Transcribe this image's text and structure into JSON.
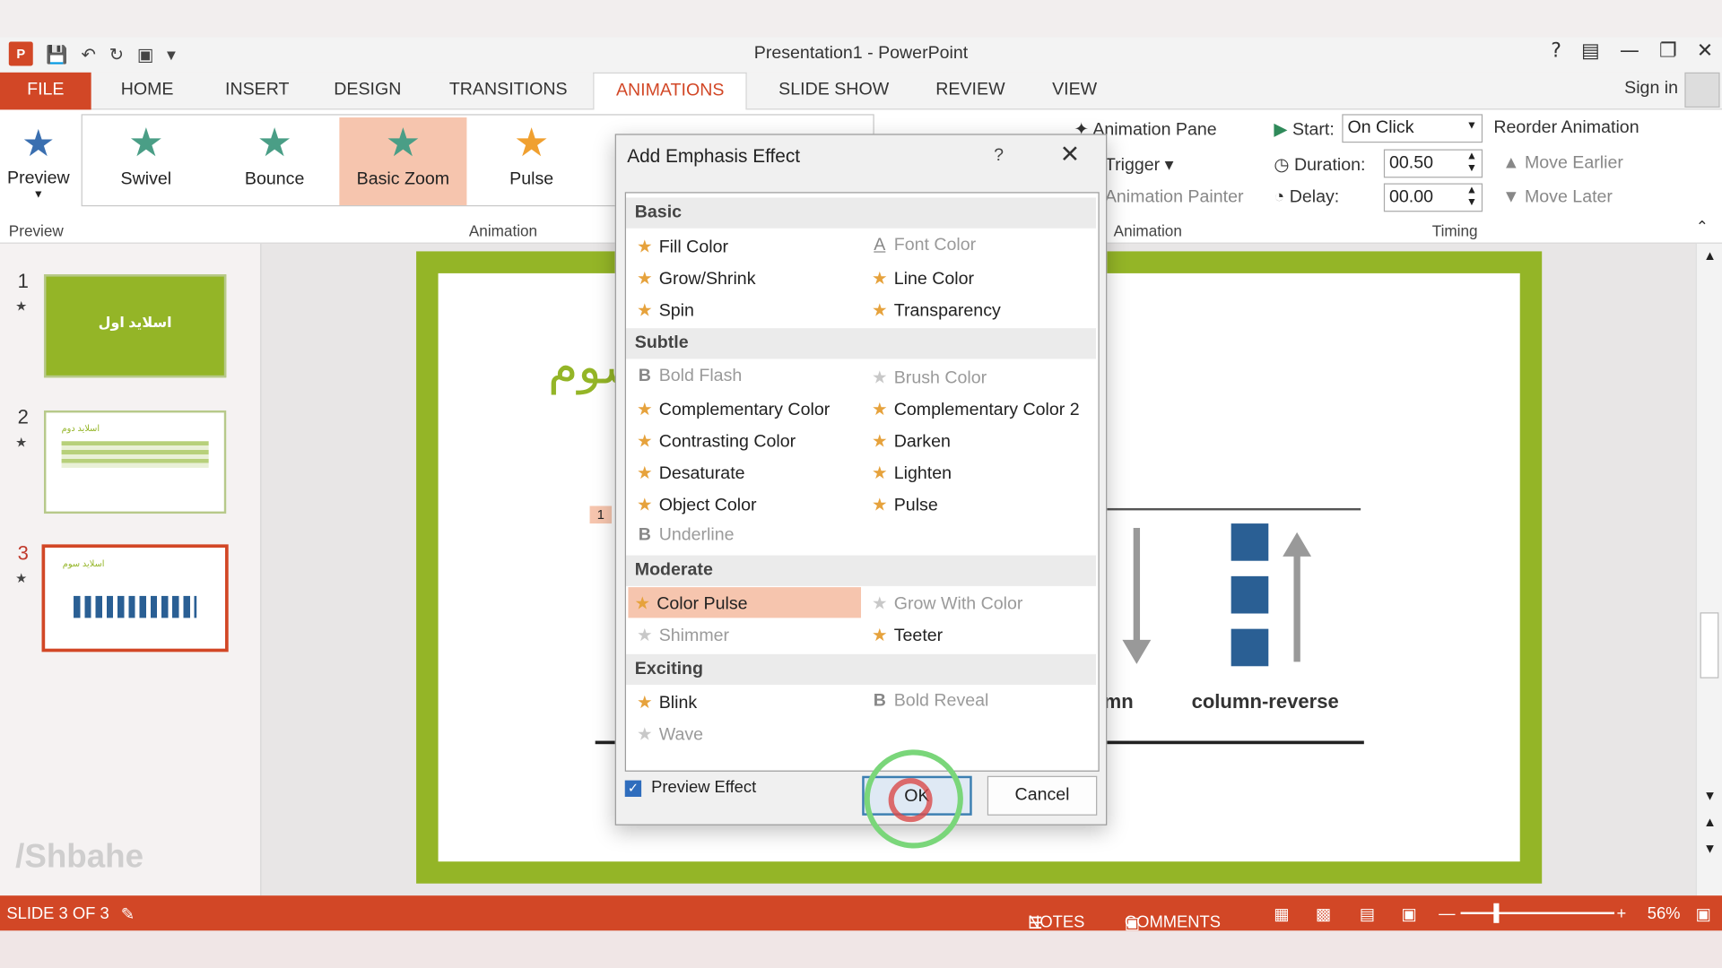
{
  "window": {
    "title": "Presentation1 - PowerPoint",
    "help": "?"
  },
  "tabs": [
    "FILE",
    "HOME",
    "INSERT",
    "DESIGN",
    "TRANSITIONS",
    "ANIMATIONS",
    "SLIDE SHOW",
    "REVIEW",
    "VIEW"
  ],
  "sign_in": "Sign in",
  "ribbon": {
    "preview_label": "Preview",
    "preview_group": "Preview",
    "animation_group": "Animation",
    "advanced_group": "Animation",
    "timing_group": "Timing",
    "gallery": [
      {
        "label": "Swivel",
        "icon": "swivel-star-icon"
      },
      {
        "label": "Bounce",
        "icon": "bounce-star-icon"
      },
      {
        "label": "Basic Zoom",
        "icon": "zoom-star-icon"
      },
      {
        "label": "Pulse",
        "icon": "pulse-star-icon"
      }
    ],
    "animation_pane": "Animation Pane",
    "trigger": "Trigger",
    "animation_painter": "Animation Painter",
    "start_label": "Start:",
    "start_value": "On Click",
    "duration_label": "Duration:",
    "duration_value": "00.50",
    "delay_label": "Delay:",
    "delay_value": "00.00",
    "reorder": "Reorder Animation",
    "move_earlier": "Move Earlier",
    "move_later": "Move Later"
  },
  "slides": [
    {
      "num": "1",
      "title": "اسلاید اول"
    },
    {
      "num": "2",
      "title": "اسلاید دوم"
    },
    {
      "num": "3",
      "title": "اسلاید سوم"
    }
  ],
  "slide": {
    "heading": "سوم",
    "seq_badge": "1",
    "label_column": "mn",
    "label_column_reverse": "column-reverse"
  },
  "dialog": {
    "title": "Add Emphasis Effect",
    "help": "?",
    "categories": {
      "basic": "Basic",
      "subtle": "Subtle",
      "moderate": "Moderate",
      "exciting": "Exciting"
    },
    "effects": {
      "fill_color": "Fill Color",
      "font_color": "Font Color",
      "grow_shrink": "Grow/Shrink",
      "line_color": "Line Color",
      "spin": "Spin",
      "transparency": "Transparency",
      "bold_flash": "Bold Flash",
      "brush_color": "Brush Color",
      "complementary_color": "Complementary Color",
      "complementary_color_2": "Complementary Color 2",
      "contrasting_color": "Contrasting Color",
      "darken": "Darken",
      "desaturate": "Desaturate",
      "lighten": "Lighten",
      "object_color": "Object Color",
      "pulse": "Pulse",
      "underline": "Underline",
      "color_pulse": "Color Pulse",
      "grow_with_color": "Grow With Color",
      "shimmer": "Shimmer",
      "teeter": "Teeter",
      "blink": "Blink",
      "bold_reveal": "Bold Reveal",
      "wave": "Wave"
    },
    "preview_effect": "Preview Effect",
    "preview_checked": true,
    "ok": "OK",
    "cancel": "Cancel"
  },
  "status": {
    "slide_info": "SLIDE 3 OF 3",
    "notes": "NOTES",
    "comments": "COMMENTS",
    "zoom": "56%"
  },
  "watermark": "/Shbahe",
  "colors": {
    "accent": "#d24726",
    "slide_border": "#94b527",
    "selection": "#f6c5ae",
    "star": "#e6a23c"
  }
}
